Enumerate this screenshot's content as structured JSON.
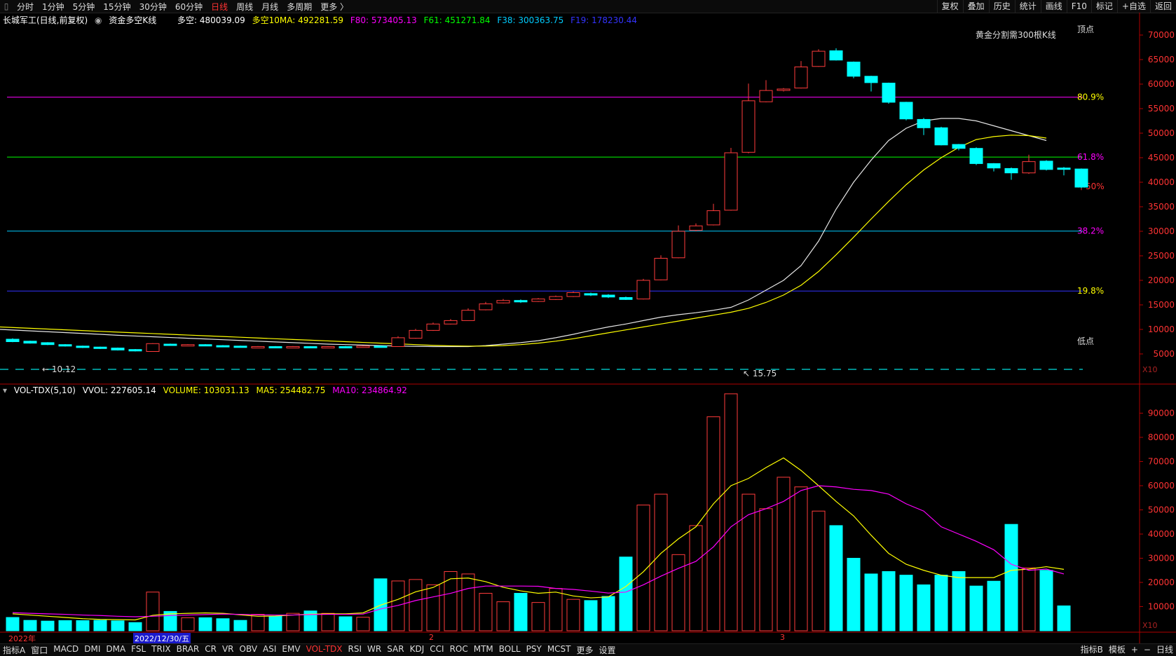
{
  "topbar": {
    "tabs": [
      "分时",
      "1分钟",
      "5分钟",
      "15分钟",
      "30分钟",
      "60分钟",
      "日线",
      "周线",
      "月线",
      "多周期",
      "更多 〉"
    ],
    "active_index": 6,
    "right_tools": [
      "复权",
      "叠加",
      "历史",
      "统计",
      "画线",
      "F10",
      "标记",
      "+自选",
      "返回"
    ]
  },
  "info": {
    "stock": "长城军工(日线,前复权)",
    "indicator": "资金多空K线",
    "duokong": "多空: 480039.09",
    "ma10": "多空10MA: 492281.59",
    "f80": "F80: 573405.13",
    "f61": "F61: 451271.84",
    "f38": "F38: 300363.75",
    "f19": "F19: 178230.44",
    "note": "黄金分割需300根K线",
    "high_label": "顶点",
    "low_label": "低点",
    "mid_label": "中50%"
  },
  "volinfo": {
    "name": "VOL-TDX(5,10)",
    "vvol": "VVOL: 227605.14",
    "volume": "VOLUME: 103031.13",
    "ma5": "MA5: 254482.75",
    "ma10": "MA10: 234864.92"
  },
  "bottombar": {
    "items": [
      "指标A",
      "窗口",
      "MACD",
      "DMI",
      "DMA",
      "FSL",
      "TRIX",
      "BRAR",
      "CR",
      "VR",
      "OBV",
      "ASI",
      "EMV",
      "VOL-TDX",
      "RSI",
      "WR",
      "SAR",
      "KDJ",
      "CCI",
      "ROC",
      "MTM",
      "BOLL",
      "PSY",
      "MCST",
      "更多",
      "设置"
    ],
    "active_index": 13,
    "right_items": [
      "指标B",
      "模板",
      "+",
      "−",
      "日线"
    ]
  },
  "datebar": {
    "year": "2022年",
    "date": "2022/12/30/五",
    "m2": "2",
    "m3": "3"
  },
  "colors": {
    "up": "#ff3b3b",
    "down": "#00ffff",
    "ma_white": "#e6e6e6",
    "ma_yellow": "#ffff00",
    "vol_ma10": "#ff00ff",
    "f80": "#ff00ff",
    "f61": "#00ff00",
    "f38": "#00ccff",
    "f19": "#3333ff"
  },
  "chart_data": [
    {
      "type": "candlestick",
      "title": "长城军工(日线,前复权) 资金多空K线",
      "ylim": [
        0,
        72000
      ],
      "y_ticks": [
        5000,
        10000,
        15000,
        20000,
        25000,
        30000,
        35000,
        40000,
        45000,
        50000,
        55000,
        60000,
        65000,
        70000
      ],
      "y_scale_label": "X10",
      "fib_levels": [
        {
          "label": "80.9%",
          "value": 57340
        },
        {
          "label": "61.8%",
          "value": 45127
        },
        {
          "label": "38.2%",
          "value": 30036
        },
        {
          "label": "19.8%",
          "value": 17823
        }
      ],
      "annotations": [
        {
          "text": "← 10.12"
        },
        {
          "text": "↖ 15.75"
        }
      ],
      "candles": [
        {
          "o": 8000,
          "c": 7500,
          "h": 8200,
          "l": 7400
        },
        {
          "o": 7600,
          "c": 7200,
          "h": 7700,
          "l": 7100
        },
        {
          "o": 7300,
          "c": 6900,
          "h": 7400,
          "l": 6800
        },
        {
          "o": 6900,
          "c": 6600,
          "h": 7000,
          "l": 6500
        },
        {
          "o": 6600,
          "c": 6300,
          "h": 6700,
          "l": 6200
        },
        {
          "o": 6400,
          "c": 6100,
          "h": 6500,
          "l": 6000
        },
        {
          "o": 6200,
          "c": 5800,
          "h": 6300,
          "l": 5700
        },
        {
          "o": 5900,
          "c": 5600,
          "h": 6000,
          "l": 5500
        },
        {
          "o": 5500,
          "c": 7100,
          "h": 7200,
          "l": 5500
        },
        {
          "o": 7000,
          "c": 6800,
          "h": 7100,
          "l": 6700
        },
        {
          "o": 6800,
          "c": 6900,
          "h": 7000,
          "l": 6700
        },
        {
          "o": 6900,
          "c": 6700,
          "h": 7000,
          "l": 6600
        },
        {
          "o": 6700,
          "c": 6600,
          "h": 6800,
          "l": 6500
        },
        {
          "o": 6600,
          "c": 6400,
          "h": 6700,
          "l": 6300
        },
        {
          "o": 6400,
          "c": 6500,
          "h": 6600,
          "l": 6300
        },
        {
          "o": 6500,
          "c": 6400,
          "h": 6600,
          "l": 6300
        },
        {
          "o": 6400,
          "c": 6500,
          "h": 6600,
          "l": 6300
        },
        {
          "o": 6500,
          "c": 6400,
          "h": 6600,
          "l": 6300
        },
        {
          "o": 6400,
          "c": 6500,
          "h": 6600,
          "l": 6300
        },
        {
          "o": 6500,
          "c": 6400,
          "h": 6600,
          "l": 6300
        },
        {
          "o": 6400,
          "c": 6600,
          "h": 6700,
          "l": 6300
        },
        {
          "o": 6600,
          "c": 6500,
          "h": 6700,
          "l": 6400
        },
        {
          "o": 6500,
          "c": 8300,
          "h": 8600,
          "l": 6500
        },
        {
          "o": 8200,
          "c": 9800,
          "h": 10100,
          "l": 8100
        },
        {
          "o": 9800,
          "c": 11100,
          "h": 11400,
          "l": 9700
        },
        {
          "o": 11100,
          "c": 11800,
          "h": 12100,
          "l": 11000
        },
        {
          "o": 11800,
          "c": 13900,
          "h": 14300,
          "l": 11800
        },
        {
          "o": 14000,
          "c": 15200,
          "h": 15600,
          "l": 13900
        },
        {
          "o": 15400,
          "c": 15900,
          "h": 16200,
          "l": 15300
        },
        {
          "o": 15900,
          "c": 15600,
          "h": 16100,
          "l": 15400
        },
        {
          "o": 15700,
          "c": 16200,
          "h": 16400,
          "l": 15600
        },
        {
          "o": 16100,
          "c": 16700,
          "h": 16900,
          "l": 16000
        },
        {
          "o": 16700,
          "c": 17500,
          "h": 17700,
          "l": 16600
        },
        {
          "o": 17300,
          "c": 17000,
          "h": 17500,
          "l": 16800
        },
        {
          "o": 17000,
          "c": 16600,
          "h": 17200,
          "l": 16400
        },
        {
          "o": 16500,
          "c": 16100,
          "h": 16700,
          "l": 16000
        },
        {
          "o": 16200,
          "c": 20000,
          "h": 20300,
          "l": 16100
        },
        {
          "o": 20100,
          "c": 24500,
          "h": 25100,
          "l": 20000
        },
        {
          "o": 24600,
          "c": 30000,
          "h": 31200,
          "l": 24500
        },
        {
          "o": 30200,
          "c": 31100,
          "h": 31600,
          "l": 30000
        },
        {
          "o": 31300,
          "c": 34200,
          "h": 35600,
          "l": 31200
        },
        {
          "o": 34300,
          "c": 46000,
          "h": 47000,
          "l": 34200
        },
        {
          "o": 46100,
          "c": 56600,
          "h": 60100,
          "l": 45900
        },
        {
          "o": 56400,
          "c": 58700,
          "h": 60800,
          "l": 56300
        },
        {
          "o": 58800,
          "c": 59000,
          "h": 59200,
          "l": 58500
        },
        {
          "o": 59200,
          "c": 63500,
          "h": 64700,
          "l": 59100
        },
        {
          "o": 63600,
          "c": 66700,
          "h": 67100,
          "l": 63500
        },
        {
          "o": 66800,
          "c": 64900,
          "h": 67300,
          "l": 64800
        },
        {
          "o": 64500,
          "c": 61600,
          "h": 64600,
          "l": 61200
        },
        {
          "o": 61600,
          "c": 60300,
          "h": 61700,
          "l": 58500
        },
        {
          "o": 60200,
          "c": 56300,
          "h": 60300,
          "l": 56000
        },
        {
          "o": 56300,
          "c": 52900,
          "h": 56400,
          "l": 52600
        },
        {
          "o": 52800,
          "c": 51100,
          "h": 53100,
          "l": 49600
        },
        {
          "o": 51100,
          "c": 47600,
          "h": 51300,
          "l": 47500
        },
        {
          "o": 47700,
          "c": 46900,
          "h": 47800,
          "l": 46500
        },
        {
          "o": 46900,
          "c": 43800,
          "h": 47100,
          "l": 43500
        },
        {
          "o": 43800,
          "c": 42900,
          "h": 43900,
          "l": 42200
        },
        {
          "o": 42800,
          "c": 41900,
          "h": 43000,
          "l": 40500
        },
        {
          "o": 41900,
          "c": 44200,
          "h": 45600,
          "l": 41700
        },
        {
          "o": 44300,
          "c": 42600,
          "h": 44500,
          "l": 42400
        },
        {
          "o": 42900,
          "c": 42700,
          "h": 43100,
          "l": 41400
        },
        {
          "o": 42700,
          "c": 39000,
          "h": 42800,
          "l": 38800
        }
      ],
      "ma_white": [
        9000,
        8800,
        8650,
        8500,
        8350,
        8200,
        8050,
        7900,
        7750,
        7600,
        7450,
        7300,
        7150,
        7000,
        6900,
        6800,
        6700,
        6600,
        6550,
        6500,
        6500,
        6500,
        6700,
        7000,
        7300,
        7700,
        8300,
        9000,
        9800,
        10500,
        11100,
        11800,
        12500,
        13000,
        13400,
        13900,
        14500,
        16000,
        18000,
        20000,
        23000,
        28000,
        34500,
        40000,
        44500,
        48500,
        51000,
        52500,
        53000,
        53000,
        52500,
        51500,
        50500,
        49500,
        48500
      ],
      "ma_yellow": [
        9600,
        9450,
        9300,
        9150,
        9000,
        8850,
        8700,
        8550,
        8400,
        8250,
        8100,
        7950,
        7800,
        7650,
        7500,
        7350,
        7200,
        7050,
        6900,
        6750,
        6650,
        6600,
        6600,
        6700,
        6900,
        7200,
        7600,
        8100,
        8700,
        9300,
        9900,
        10500,
        11100,
        11700,
        12300,
        12900,
        13500,
        14300,
        15500,
        17000,
        19000,
        21800,
        25200,
        28800,
        32500,
        36100,
        39500,
        42500,
        45000,
        47100,
        48700,
        49300,
        49600,
        49500,
        49000
      ],
      "x_labels": [
        "2022年",
        "2022/12/30/五",
        "2",
        "3"
      ]
    },
    {
      "type": "bar",
      "title": "VOL-TDX(5,10)",
      "ylim": [
        0,
        100000
      ],
      "y_ticks": [
        10000,
        20000,
        30000,
        40000,
        50000,
        60000,
        70000,
        80000,
        90000
      ],
      "y_scale_label": "X10",
      "volumes": [
        5500,
        4300,
        4000,
        4200,
        4200,
        4300,
        4100,
        3400,
        16000,
        8000,
        5400,
        5400,
        5000,
        4300,
        6800,
        6100,
        7200,
        8200,
        7200,
        5800,
        5600,
        21500,
        20600,
        21200,
        19000,
        24500,
        23500,
        15500,
        12000,
        15500,
        11700,
        17500,
        13000,
        12500,
        14200,
        30500,
        52000,
        56500,
        31500,
        43500,
        88500,
        98000,
        56500,
        50500,
        63500,
        59500,
        49500,
        43500,
        30000,
        23500,
        24500,
        23000,
        19000,
        23000,
        24500,
        18500,
        20500,
        44000,
        26000,
        25000,
        10300
      ],
      "ma5": [
        7000,
        6500,
        6000,
        5500,
        5000,
        4700,
        4600,
        4500,
        6400,
        7000,
        7200,
        7400,
        7200,
        6600,
        6000,
        6100,
        6500,
        6900,
        7000,
        7000,
        7400,
        10600,
        13000,
        16100,
        17900,
        21500,
        21800,
        20300,
        18000,
        16500,
        15500,
        16000,
        14400,
        13600,
        14000,
        18300,
        24400,
        32000,
        38000,
        43000,
        52500,
        60000,
        63000,
        67500,
        71500,
        66300,
        60000,
        53500,
        47500,
        39500,
        32000,
        27500,
        25000,
        23000,
        22000,
        22000,
        22000,
        25000,
        25500,
        26500,
        25400
      ],
      "ma10": [
        7500,
        7200,
        7000,
        6800,
        6500,
        6300,
        6000,
        5800,
        6000,
        6300,
        6500,
        6700,
        6900,
        6800,
        6600,
        6500,
        6500,
        6700,
        6800,
        6800,
        6900,
        9000,
        10500,
        12500,
        14000,
        15500,
        17500,
        18500,
        18500,
        18500,
        18400,
        17500,
        17100,
        16400,
        15600,
        16000,
        19000,
        22600,
        25800,
        28700,
        34700,
        43000,
        48000,
        50500,
        53500,
        58000,
        60000,
        59500,
        58500,
        58000,
        56500,
        52500,
        49500,
        43000,
        40000,
        37000,
        33500,
        27500,
        25000,
        25500,
        23500
      ]
    }
  ]
}
